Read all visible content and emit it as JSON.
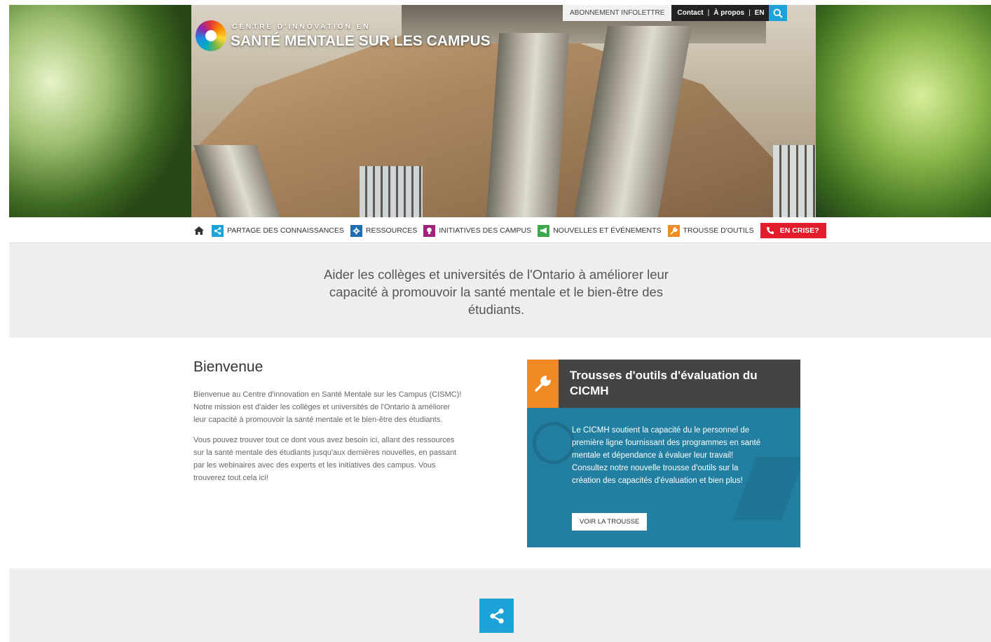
{
  "header": {
    "logo_small": "CENTRE D'INNOVATION EN",
    "logo_big": "SANTÉ MENTALE SUR LES CAMPUS",
    "newsletter": "ABONNEMENT INFOLETTRE",
    "contact": "Contact",
    "about": "À propos",
    "lang": "EN",
    "separator": "|"
  },
  "nav": {
    "items": [
      {
        "label": "PARTAGE DES CONNAISSANCES",
        "icon": "share-icon",
        "color": "#1ea3d8"
      },
      {
        "label": "RESSOURCES",
        "icon": "gear-icon",
        "color": "#1f6db3"
      },
      {
        "label": "INITIATIVES DES CAMPUS",
        "icon": "lightbulb-icon",
        "color": "#a0257a"
      },
      {
        "label": "NOUVELLES ET ÉVÉNEMENTS",
        "icon": "megaphone-icon",
        "color": "#3fa84c"
      },
      {
        "label": "TROUSSE D'OUTILS",
        "icon": "wrench-icon",
        "color": "#f08a24"
      }
    ],
    "crisis": {
      "label": "EN CRISE?",
      "icon": "phone-icon",
      "color": "#e21c2a"
    }
  },
  "mission": {
    "text": "Aider les collèges et universités de l'Ontario à améliorer leur capacité à promouvoir la santé mentale et le bien-être des étudiants."
  },
  "welcome": {
    "title": "Bienvenue",
    "p1": "Bienvenue au Centre d'innovation en Santé Mentale sur les Campus (CISMC)! Notre mission est d'aider les collèges et universités de l'Ontario à améliorer leur capacité à promouvoir la santé mentale et le bien-être des étudiants.",
    "p2": "Vous pouvez trouver tout ce dont vous avez besoin ici, allant des ressources sur la santé mentale des étudiants jusqu'aux dernières nouvelles, en passant par les webinaires avec des experts et les initiatives des campus. Vous trouverez tout cela ici!"
  },
  "toolkit": {
    "title": "Trousses d'outils d'évaluation du CICMH",
    "text": "Le CICMH soutient la capacité du le personnel de première ligne fournissant des programmes en santé mentale et dépendance à évaluer leur travail! Consultez notre nouvelle trousse d'outils sur la création des capacités d'évaluation et bien plus!",
    "button": "VOIR LA TROUSSE"
  },
  "colors": {
    "accent": "#1ea3d8",
    "card_header": "#444444",
    "card_body": "#227fa1",
    "toolkit_orange": "#f08a24",
    "crisis_red": "#e21c2a"
  }
}
